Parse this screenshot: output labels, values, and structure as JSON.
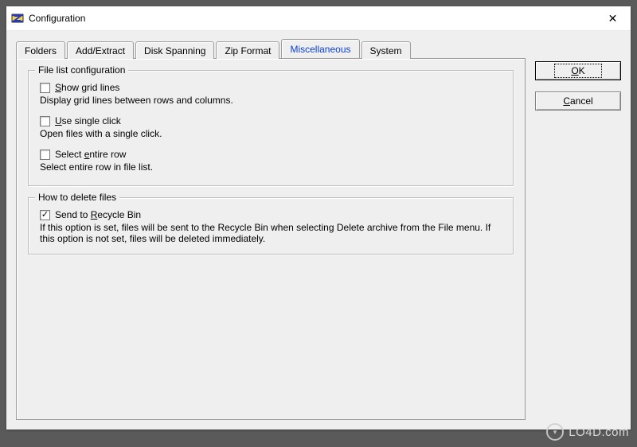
{
  "window": {
    "title": "Configuration",
    "close_glyph": "✕"
  },
  "tabs": [
    {
      "label": "Folders",
      "active": false
    },
    {
      "label": "Add/Extract",
      "active": false
    },
    {
      "label": "Disk Spanning",
      "active": false
    },
    {
      "label": "Zip Format",
      "active": false
    },
    {
      "label": "Miscellaneous",
      "active": true
    },
    {
      "label": "System",
      "active": false
    }
  ],
  "buttons": {
    "ok_prefix": "O",
    "ok_rest": "K",
    "cancel_prefix": "C",
    "cancel_rest": "ancel"
  },
  "groups": {
    "file_list": {
      "legend": "File list configuration",
      "show_grid": {
        "checked": false,
        "before": "S",
        "rest": "how grid lines",
        "desc": "Display grid lines between rows and columns."
      },
      "single_click": {
        "checked": false,
        "before": "U",
        "rest": "se single click",
        "desc": "Open files with a single click."
      },
      "select_row": {
        "checked": false,
        "pre": "Select ",
        "u": "e",
        "rest": "ntire row",
        "desc": "Select entire row in file list."
      }
    },
    "delete": {
      "legend": "How to delete files",
      "recycle": {
        "checked": true,
        "pre": "Send to ",
        "u": "R",
        "rest": "ecycle Bin",
        "desc": "If this option is set, files will be sent to the Recycle Bin when selecting Delete archive from the File menu. If this option is not set, files will be deleted immediately."
      }
    }
  },
  "watermark": {
    "text": "LO4D.com"
  }
}
